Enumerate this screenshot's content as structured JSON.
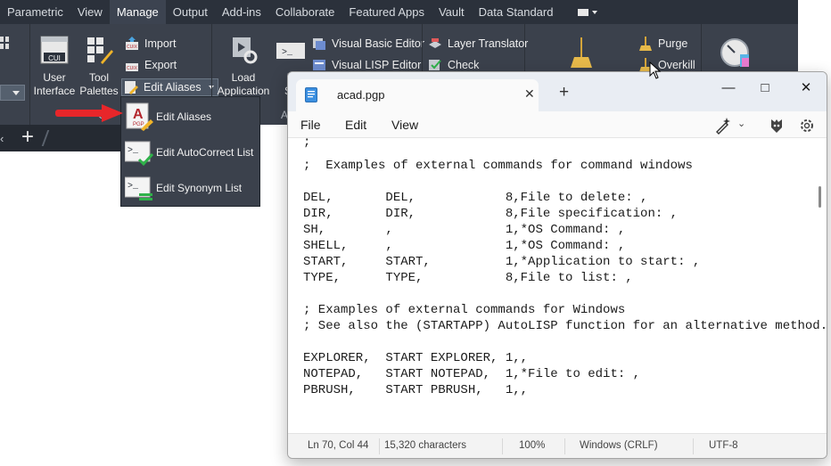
{
  "ribbon": {
    "tabs": [
      "Parametric",
      "View",
      "Manage",
      "Output",
      "Add-ins",
      "Collaborate",
      "Featured Apps",
      "Vault",
      "Data Standard"
    ],
    "active_tab": "Manage",
    "buttons": {
      "cui_label": "CUI",
      "user_interface_line1": "User",
      "user_interface_line2": "Interface",
      "tool_palettes_line1": "Tool",
      "tool_palettes_line2": "Palettes",
      "import": "Import",
      "export": "Export",
      "edit_aliases": "Edit Aliases",
      "load_application_line1": "Load",
      "load_application_line2": "Application",
      "run_script_line1": "R",
      "run_script_line2": "Sc",
      "visual_basic_editor": "Visual Basic Editor",
      "visual_lisp_editor": "Visual LISP Editor",
      "layer_translator": "Layer Translator",
      "check": "Check",
      "purge": "Purge",
      "overkill": "Overkill",
      "cuix_badge": "CUIX"
    },
    "panel_labels": {
      "customization_partial": "C",
      "applications_partial": "A"
    }
  },
  "flyout": {
    "items": [
      {
        "label": "Edit Aliases"
      },
      {
        "label": "Edit AutoCorrect List"
      },
      {
        "label": "Edit Synonym List"
      }
    ],
    "pgp_badge": "PGP",
    "alias_letter": "A"
  },
  "notepad": {
    "tab_title": "acad.pgp",
    "menu": [
      "File",
      "Edit",
      "View"
    ],
    "lines": [
      ";",
      ";  Examples of external commands for command windows",
      "",
      "DEL,       DEL,            8,File to delete: ,",
      "DIR,       DIR,            8,File specification: ,",
      "SH,        ,               1,*OS Command: ,",
      "SHELL,     ,               1,*OS Command: ,",
      "START,     START,          1,*Application to start: ,",
      "TYPE,      TYPE,           8,File to list: ,",
      "",
      "; Examples of external commands for Windows",
      "; See also the (STARTAPP) AutoLISP function for an alternative method.",
      "",
      "EXPLORER,  START EXPLORER, 1,,",
      "NOTEPAD,   START NOTEPAD,  1,*File to edit: ,",
      "PBRUSH,    START PBRUSH,   1,,"
    ],
    "status": {
      "position": "Ln 70, Col 44",
      "characters": "15,320 characters",
      "zoom": "100%",
      "line_ending": "Windows (CRLF)",
      "encoding": "UTF-8"
    }
  },
  "colors": {
    "ribbon_bg": "#3b414c",
    "tabbar_bg": "#2b313b",
    "arrow_red": "#e8262a",
    "notepad_bg": "#f3f3f3"
  }
}
